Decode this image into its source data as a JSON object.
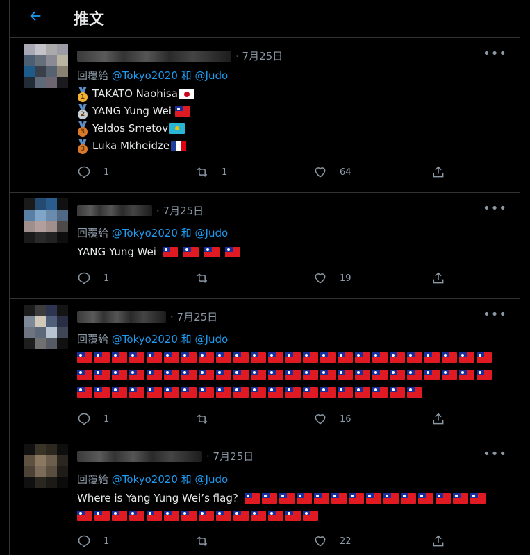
{
  "header": {
    "title": "推文"
  },
  "tweets": [
    {
      "date": "· 7月25日",
      "reply_prefix": "回覆給",
      "mention1": "@Tokyo2020",
      "conj": "和",
      "mention2": "@Judo",
      "medals": [
        {
          "rank": "1",
          "name": "TAKATO Naohisa",
          "flag": "japan-flag"
        },
        {
          "rank": "2",
          "name": "YANG Yung Wei",
          "flag": "taiwan-flag"
        },
        {
          "rank": "3",
          "name": "Yeldos Smetov",
          "flag": "kazakhstan-flag"
        },
        {
          "rank": "3",
          "name": "Luka Mkheidze",
          "flag": "france-flag"
        }
      ],
      "replies": "1",
      "retweets": "1",
      "likes": "64"
    },
    {
      "date": "· 7月25日",
      "reply_prefix": "回覆給",
      "mention1": "@Tokyo2020",
      "conj": "和",
      "mention2": "@Judo",
      "text": "YANG Yung Wei",
      "flag_count": 4,
      "replies": "1",
      "retweets": "",
      "likes": "19"
    },
    {
      "date": "· 7月25日",
      "reply_prefix": "回覆給",
      "mention1": "@Tokyo2020",
      "conj": "和",
      "mention2": "@Judo",
      "flag_rows": [
        24,
        24,
        20
      ],
      "replies": "1",
      "retweets": "",
      "likes": "16"
    },
    {
      "date": "· 7月25日",
      "reply_prefix": "回覆給",
      "mention1": "@Tokyo2020",
      "conj": "和",
      "mention2": "@Judo",
      "text": "Where is Yang Yung Wei’s flag?",
      "flag_rows": [
        14,
        14
      ],
      "replies": "1",
      "retweets": "",
      "likes": "22"
    }
  ],
  "colors": {
    "accent": "#1d9bf0",
    "muted": "#8b98a5",
    "text": "#e7e9ea",
    "border": "#2f3336"
  },
  "icons": [
    "back-arrow-icon",
    "more-icon",
    "reply-icon",
    "retweet-icon",
    "like-icon",
    "share-icon"
  ]
}
